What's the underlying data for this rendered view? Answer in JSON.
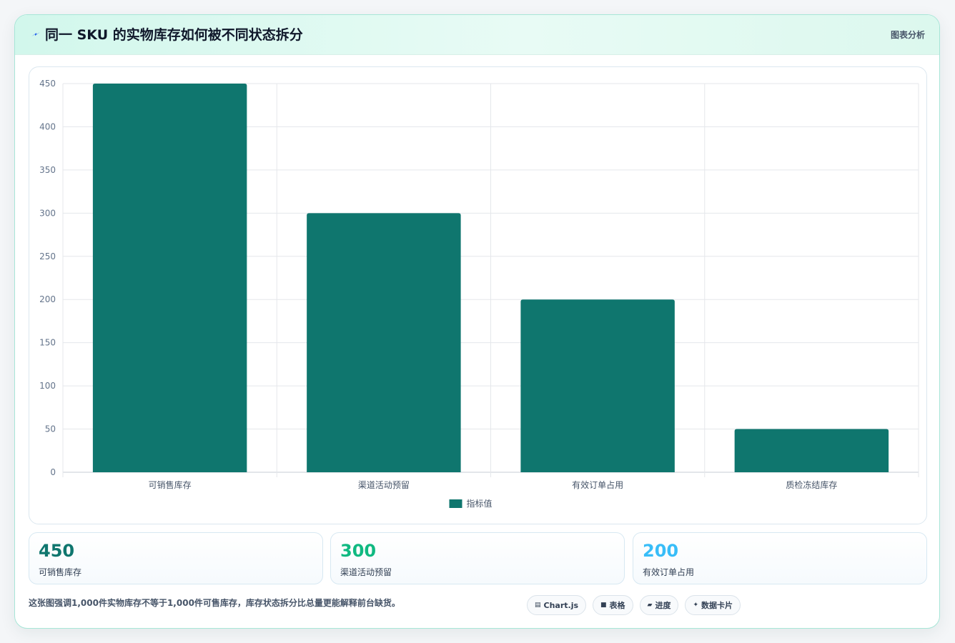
{
  "header": {
    "title": "同一 SKU 的实物库存如何被不同状态拆分",
    "tag": "图表分析",
    "icon": "lightning-icon",
    "icon_color": "#2563eb"
  },
  "chart_data": {
    "type": "bar",
    "categories": [
      "可销售库存",
      "渠道活动预留",
      "有效订单占用",
      "质检冻结库存"
    ],
    "series": [
      {
        "name": "指标值",
        "values": [
          450,
          300,
          200,
          50
        ],
        "color": "#0f766e"
      }
    ],
    "ylim": [
      0,
      450
    ],
    "yticks": [
      0,
      50,
      100,
      150,
      200,
      250,
      300,
      350,
      400,
      450
    ],
    "grid": true,
    "legend": "bottom"
  },
  "stats": [
    {
      "value": "450",
      "label": "可销售库存",
      "color": "#0f766e"
    },
    {
      "value": "300",
      "label": "渠道活动预留",
      "color": "#10b981"
    },
    {
      "value": "200",
      "label": "有效订单占用",
      "color": "#38bdf8"
    }
  ],
  "footer": {
    "text": "这张图强调1,000件实物库存不等于1,000件可售库存，库存状态拆分比总量更能解释前台缺货。",
    "chips": [
      {
        "icon": "chart-icon",
        "glyph": "▤",
        "label": "Chart.js"
      },
      {
        "icon": "table-icon",
        "glyph": "■",
        "label": "表格"
      },
      {
        "icon": "progress-icon",
        "glyph": "▰",
        "label": "进度"
      },
      {
        "icon": "sparkle-icon",
        "glyph": "✦",
        "label": "数据卡片"
      }
    ]
  }
}
